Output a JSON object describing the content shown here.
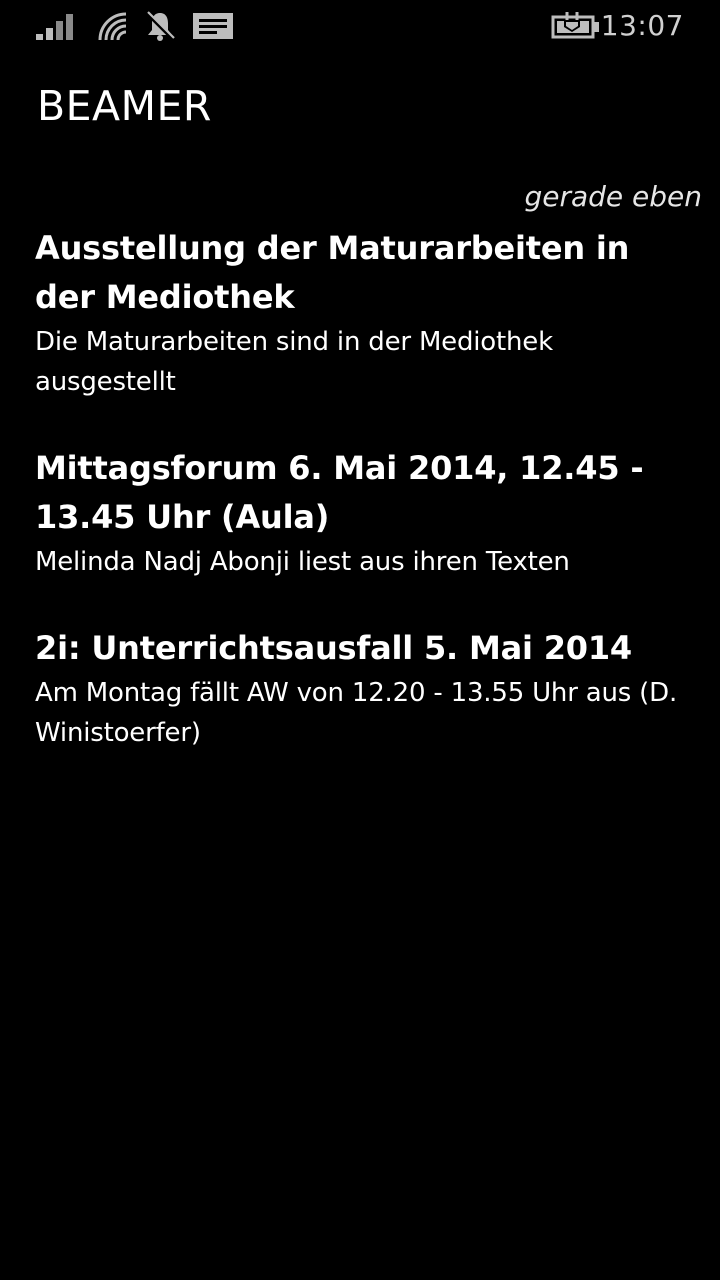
{
  "status_bar": {
    "time": "13:07",
    "icons": [
      "signal-strength-icon",
      "wifi-icon",
      "notifications-muted-icon",
      "message-icon",
      "battery-charging-icon"
    ],
    "icon_color": "#bdbdbd"
  },
  "app": {
    "title": "BEAMER"
  },
  "feed": {
    "timestamp": "gerade eben",
    "items": [
      {
        "title": "Ausstellung der Maturarbeiten in der Mediothek",
        "body": "Die Maturarbeiten sind in der Mediothek ausgestellt"
      },
      {
        "title": "Mittagsforum 6. Mai 2014, 12.45 - 13.45 Uhr (Aula)",
        "body": "Melinda Nadj Abonji liest aus ihren Texten"
      },
      {
        "title": "2i: Unterrichtsausfall 5. Mai 2014",
        "body": "Am Montag fällt AW von 12.20 - 13.55 Uhr aus (D. Winistoerfer)"
      }
    ]
  },
  "colors": {
    "background": "#000000",
    "text": "#ffffff"
  }
}
